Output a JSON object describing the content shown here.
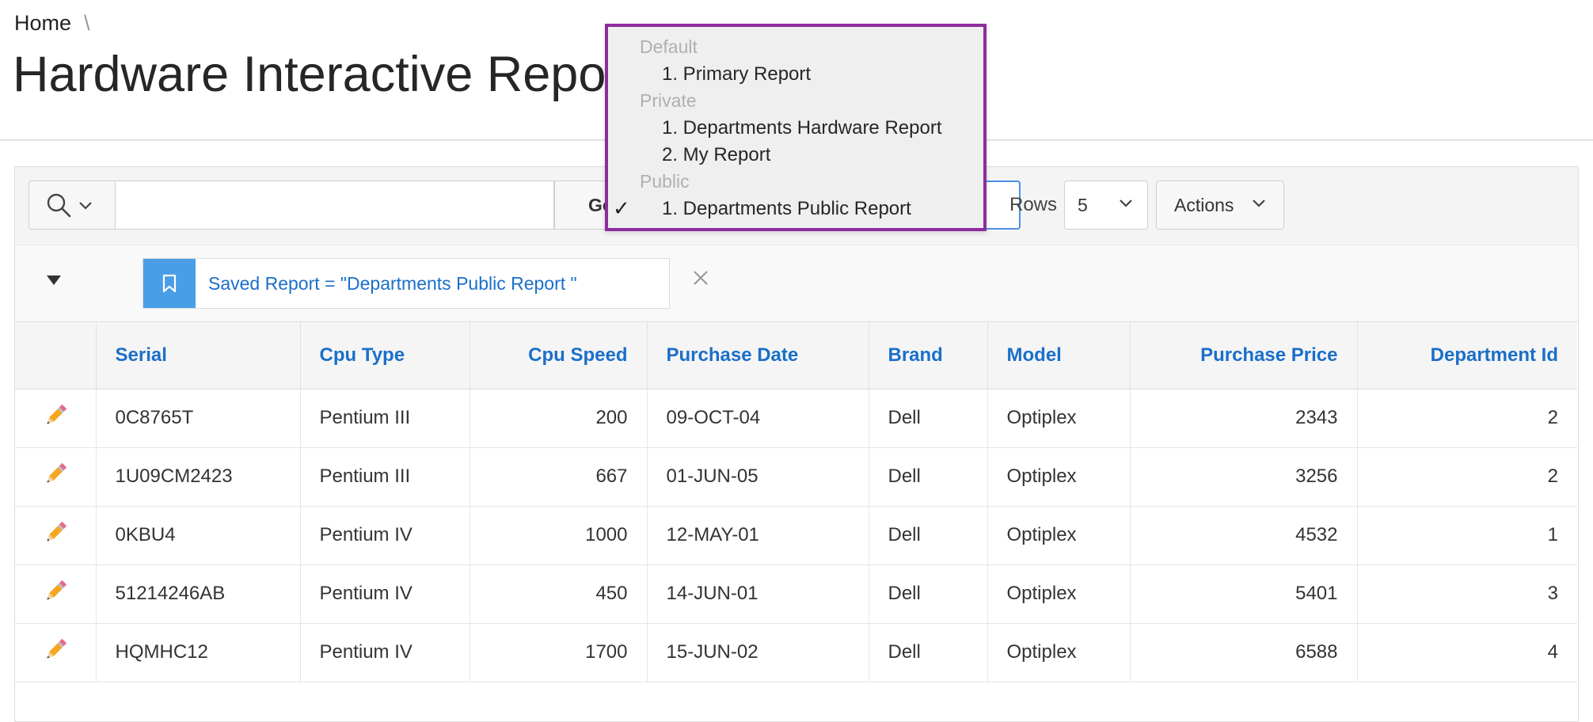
{
  "breadcrumb": {
    "home": "Home",
    "separator": "\\"
  },
  "page": {
    "title": "Hardware Interactive Report"
  },
  "toolbar": {
    "search_placeholder": "",
    "go_label": "Go",
    "rows_label": "Rows",
    "rows_value": "5",
    "actions_label": "Actions"
  },
  "filter": {
    "chip_text": "Saved Report = \"Departments Public Report \"",
    "accent_color": "#4a9ee8"
  },
  "report_menu": {
    "groups": [
      {
        "label": "Default",
        "options": [
          {
            "label": "1. Primary Report",
            "selected": false
          }
        ]
      },
      {
        "label": "Private",
        "options": [
          {
            "label": "1. Departments Hardware Report",
            "selected": false
          },
          {
            "label": "2. My Report",
            "selected": false
          }
        ]
      },
      {
        "label": "Public",
        "options": [
          {
            "label": "1. Departments Public Report",
            "selected": true
          }
        ]
      }
    ],
    "check_mark": "✓",
    "border_color": "#8e2c9e"
  },
  "table": {
    "headers": [
      "Serial",
      "Cpu Type",
      "Cpu Speed",
      "Purchase Date",
      "Brand",
      "Model",
      "Purchase Price",
      "Department Id"
    ],
    "rows": [
      [
        "0C8765T",
        "Pentium III",
        "200",
        "09-OCT-04",
        "Dell",
        "Optiplex",
        "2343",
        "2"
      ],
      [
        "1U09CM2423",
        "Pentium III",
        "667",
        "01-JUN-05",
        "Dell",
        "Optiplex",
        "3256",
        "2"
      ],
      [
        "0KBU4",
        "Pentium IV",
        "1000",
        "12-MAY-01",
        "Dell",
        "Optiplex",
        "4532",
        "1"
      ],
      [
        "51214246AB",
        "Pentium IV",
        "450",
        "14-JUN-01",
        "Dell",
        "Optiplex",
        "5401",
        "3"
      ],
      [
        "HQMHC12",
        "Pentium IV",
        "1700",
        "15-JUN-02",
        "Dell",
        "Optiplex",
        "6588",
        "4"
      ]
    ],
    "header_color": "#1a6fc9",
    "edit_icon": "pencil-icon"
  }
}
